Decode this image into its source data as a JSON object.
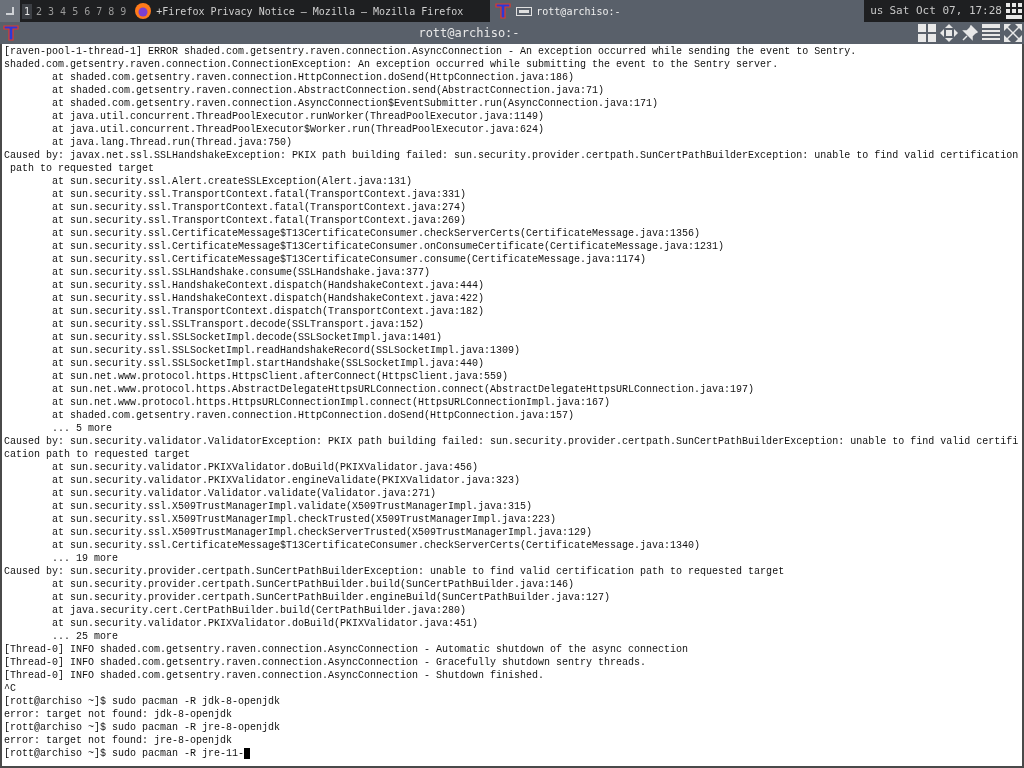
{
  "taskbar": {
    "workspaces": [
      {
        "label": "1",
        "selected": true
      },
      {
        "label": "2",
        "selected": false
      },
      {
        "label": "3",
        "selected": false
      },
      {
        "label": "4",
        "selected": false
      },
      {
        "label": "5",
        "selected": false
      },
      {
        "label": "6",
        "selected": false
      },
      {
        "label": "7",
        "selected": false
      },
      {
        "label": "8",
        "selected": false
      },
      {
        "label": "9",
        "selected": false
      }
    ],
    "tasks": [
      {
        "kind": "browser",
        "title": "+Firefox Privacy Notice — Mozilla — Mozilla Firefox",
        "selected": false
      },
      {
        "kind": "terminal",
        "title": "rott@archiso:-",
        "selected": true
      }
    ],
    "keyboard_layout": "us",
    "clock": "Sat Oct 07, 17:28"
  },
  "window": {
    "title": "rott@archiso:-"
  },
  "terminal": {
    "lines": [
      "[raven-pool-1-thread-1] ERROR shaded.com.getsentry.raven.connection.AsyncConnection - An exception occurred while sending the event to Sentry.",
      "shaded.com.getsentry.raven.connection.ConnectionException: An exception occurred while submitting the event to the Sentry server.",
      "        at shaded.com.getsentry.raven.connection.HttpConnection.doSend(HttpConnection.java:186)",
      "        at shaded.com.getsentry.raven.connection.AbstractConnection.send(AbstractConnection.java:71)",
      "        at shaded.com.getsentry.raven.connection.AsyncConnection$EventSubmitter.run(AsyncConnection.java:171)",
      "        at java.util.concurrent.ThreadPoolExecutor.runWorker(ThreadPoolExecutor.java:1149)",
      "        at java.util.concurrent.ThreadPoolExecutor$Worker.run(ThreadPoolExecutor.java:624)",
      "        at java.lang.Thread.run(Thread.java:750)",
      "Caused by: javax.net.ssl.SSLHandshakeException: PKIX path building failed: sun.security.provider.certpath.SunCertPathBuilderException: unable to find valid certification",
      " path to requested target",
      "        at sun.security.ssl.Alert.createSSLException(Alert.java:131)",
      "        at sun.security.ssl.TransportContext.fatal(TransportContext.java:331)",
      "        at sun.security.ssl.TransportContext.fatal(TransportContext.java:274)",
      "        at sun.security.ssl.TransportContext.fatal(TransportContext.java:269)",
      "        at sun.security.ssl.CertificateMessage$T13CertificateConsumer.checkServerCerts(CertificateMessage.java:1356)",
      "        at sun.security.ssl.CertificateMessage$T13CertificateConsumer.onConsumeCertificate(CertificateMessage.java:1231)",
      "        at sun.security.ssl.CertificateMessage$T13CertificateConsumer.consume(CertificateMessage.java:1174)",
      "        at sun.security.ssl.SSLHandshake.consume(SSLHandshake.java:377)",
      "        at sun.security.ssl.HandshakeContext.dispatch(HandshakeContext.java:444)",
      "        at sun.security.ssl.HandshakeContext.dispatch(HandshakeContext.java:422)",
      "        at sun.security.ssl.TransportContext.dispatch(TransportContext.java:182)",
      "        at sun.security.ssl.SSLTransport.decode(SSLTransport.java:152)",
      "        at sun.security.ssl.SSLSocketImpl.decode(SSLSocketImpl.java:1401)",
      "        at sun.security.ssl.SSLSocketImpl.readHandshakeRecord(SSLSocketImpl.java:1309)",
      "        at sun.security.ssl.SSLSocketImpl.startHandshake(SSLSocketImpl.java:440)",
      "        at sun.net.www.protocol.https.HttpsClient.afterConnect(HttpsClient.java:559)",
      "        at sun.net.www.protocol.https.AbstractDelegateHttpsURLConnection.connect(AbstractDelegateHttpsURLConnection.java:197)",
      "        at sun.net.www.protocol.https.HttpsURLConnectionImpl.connect(HttpsURLConnectionImpl.java:167)",
      "        at shaded.com.getsentry.raven.connection.HttpConnection.doSend(HttpConnection.java:157)",
      "        ... 5 more",
      "Caused by: sun.security.validator.ValidatorException: PKIX path building failed: sun.security.provider.certpath.SunCertPathBuilderException: unable to find valid certifi",
      "cation path to requested target",
      "        at sun.security.validator.PKIXValidator.doBuild(PKIXValidator.java:456)",
      "        at sun.security.validator.PKIXValidator.engineValidate(PKIXValidator.java:323)",
      "        at sun.security.validator.Validator.validate(Validator.java:271)",
      "        at sun.security.ssl.X509TrustManagerImpl.validate(X509TrustManagerImpl.java:315)",
      "        at sun.security.ssl.X509TrustManagerImpl.checkTrusted(X509TrustManagerImpl.java:223)",
      "        at sun.security.ssl.X509TrustManagerImpl.checkServerTrusted(X509TrustManagerImpl.java:129)",
      "        at sun.security.ssl.CertificateMessage$T13CertificateConsumer.checkServerCerts(CertificateMessage.java:1340)",
      "        ... 19 more",
      "Caused by: sun.security.provider.certpath.SunCertPathBuilderException: unable to find valid certification path to requested target",
      "        at sun.security.provider.certpath.SunCertPathBuilder.build(SunCertPathBuilder.java:146)",
      "        at sun.security.provider.certpath.SunCertPathBuilder.engineBuild(SunCertPathBuilder.java:127)",
      "        at java.security.cert.CertPathBuilder.build(CertPathBuilder.java:280)",
      "        at sun.security.validator.PKIXValidator.doBuild(PKIXValidator.java:451)",
      "        ... 25 more",
      "[Thread-0] INFO shaded.com.getsentry.raven.connection.AsyncConnection - Automatic shutdown of the async connection",
      "[Thread-0] INFO shaded.com.getsentry.raven.connection.AsyncConnection - Gracefully shutdown sentry threads.",
      "[Thread-0] INFO shaded.com.getsentry.raven.connection.AsyncConnection - Shutdown finished.",
      "^C",
      "[rott@archiso ~]$ sudo pacman -R jdk-8-openjdk",
      "error: target not found: jdk-8-openjdk",
      "[rott@archiso ~]$ sudo pacman -R jre-8-openjdk",
      "error: target not found: jre-8-openjdk",
      "[rott@archiso ~]$ sudo pacman -R jre-11-"
    ]
  }
}
